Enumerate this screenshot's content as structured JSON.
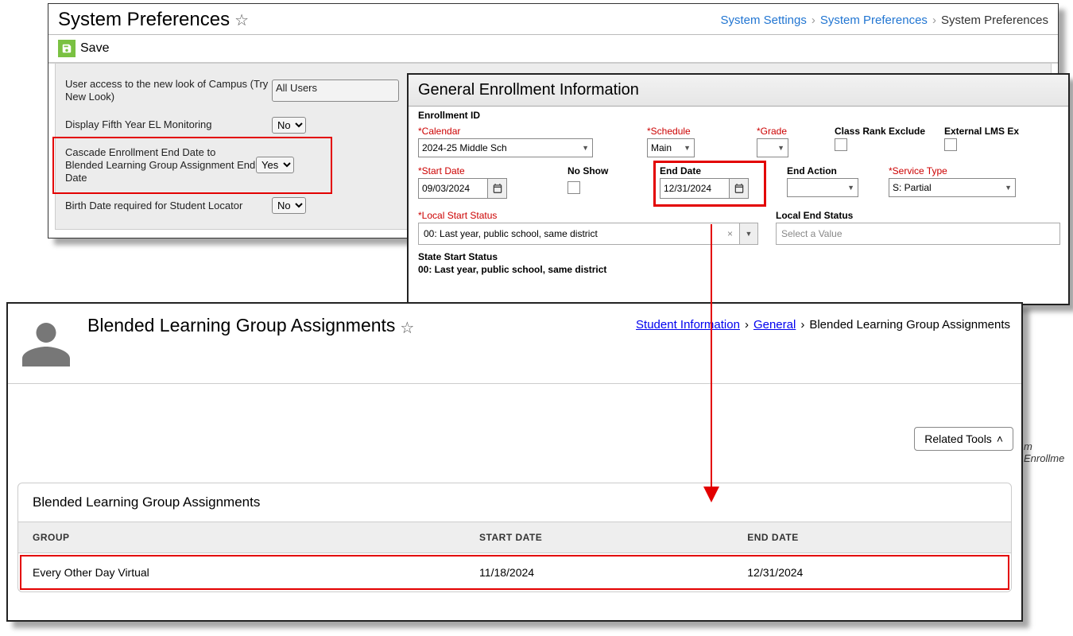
{
  "sysprefs": {
    "title": "System Preferences",
    "breadcrumb": [
      "System Settings",
      "System Preferences",
      "System Preferences"
    ],
    "save_label": "Save",
    "rows": {
      "new_look": {
        "label": "User access to the new look of Campus (Try New Look)",
        "value": "All Users"
      },
      "fifth_year": {
        "label": "Display Fifth Year EL Monitoring",
        "value": "No"
      },
      "cascade": {
        "label": "Cascade Enrollment End Date to Blended Learning Group Assignment End Date",
        "value": "Yes"
      },
      "birth": {
        "label": "Birth Date required for Student Locator",
        "value": "No"
      }
    }
  },
  "enroll": {
    "title": "General Enrollment Information",
    "enrollment_id_label": "Enrollment ID",
    "fields": {
      "calendar": {
        "label": "*Calendar",
        "value": "2024-25 Middle Sch"
      },
      "schedule": {
        "label": "*Schedule",
        "value": "Main"
      },
      "grade": {
        "label": "*Grade",
        "value": ""
      },
      "class_rank": {
        "label": "Class Rank Exclude"
      },
      "ext_lms": {
        "label": "External LMS Ex"
      },
      "start_date": {
        "label": "*Start Date",
        "value": "09/03/2024"
      },
      "no_show": {
        "label": "No Show"
      },
      "end_date": {
        "label": "End Date",
        "value": "12/31/2024"
      },
      "end_action": {
        "label": "End Action",
        "value": ""
      },
      "service": {
        "label": "*Service Type",
        "value": "S: Partial"
      },
      "local_start": {
        "label": "*Local Start Status",
        "value": "00: Last year, public school, same district"
      },
      "local_end": {
        "label": "Local End Status",
        "placeholder": "Select a Value"
      },
      "state_start_label": "State Start Status",
      "state_start_value": "00: Last year, public school, same district"
    }
  },
  "blended": {
    "title": "Blended Learning Group Assignments",
    "breadcrumb": [
      "Student Information",
      "General",
      "Blended Learning Group Assignments"
    ],
    "related_tools": "Related Tools",
    "section_title": "Blended Learning Group Assignments",
    "columns": [
      "GROUP",
      "START DATE",
      "END DATE"
    ],
    "row": {
      "group": "Every Other Day Virtual",
      "start": "11/18/2024",
      "end": "12/31/2024"
    },
    "side_text": "m Enrollme"
  }
}
